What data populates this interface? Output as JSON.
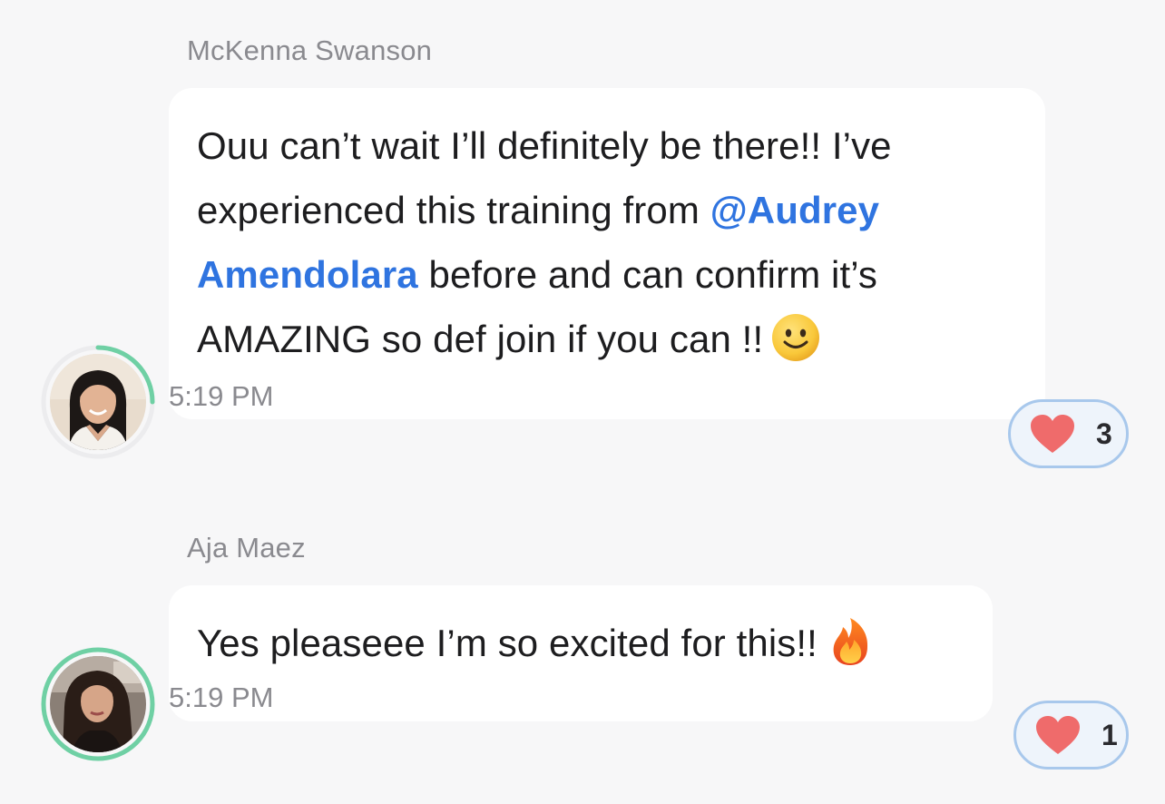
{
  "messages": [
    {
      "sender": "McKenna Swanson",
      "text_parts": [
        "Ouu can’t wait I’ll definitely be there!! I’ve experienced this training from ",
        "@Audrey Amendolara",
        " before and can confirm it’s AMAZING so def join if you can !!"
      ],
      "emoji": "slightly-smiling-face-icon",
      "time": "5:19 PM",
      "reaction": {
        "icon": "heart-icon",
        "count": "3"
      },
      "avatar_ring_progress": 0.25
    },
    {
      "sender": "Aja Maez",
      "text_parts": [
        "Yes pleaseee I’m so excited for this!!"
      ],
      "emoji": "fire-icon",
      "time": "5:19 PM",
      "reaction": {
        "icon": "heart-icon",
        "count": "1"
      },
      "avatar_ring_progress": 1.0
    }
  ],
  "colors": {
    "mention": "#2f74e0",
    "ring": "#6fd0a4",
    "heart": "#ef6b6b",
    "reaction_border": "#a8c8ec"
  }
}
